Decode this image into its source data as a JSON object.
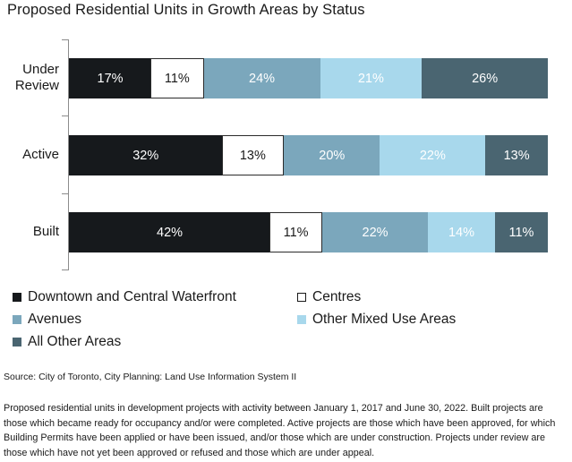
{
  "chart_data": {
    "type": "bar",
    "orientation": "horizontal",
    "stacked": true,
    "normalized": true,
    "title": "Proposed Residential Units in Growth Areas by Status",
    "xlabel": "",
    "ylabel": "",
    "grid": false,
    "legend_position": "bottom",
    "xlim": [
      0,
      100
    ],
    "categories": [
      "Under Review",
      "Active",
      "Built"
    ],
    "series": [
      {
        "name": "Downtown and Central Waterfront",
        "color": "#16191c",
        "text_color": "#ffffff",
        "outlined": false,
        "values": [
          17,
          32,
          42
        ],
        "labels": [
          "17%",
          "32%",
          "42%"
        ]
      },
      {
        "name": "Centres",
        "color": "#ffffff",
        "text_color": "#1a1a1a",
        "outlined": true,
        "values": [
          11,
          13,
          11
        ],
        "labels": [
          "11%",
          "13%",
          "11%"
        ]
      },
      {
        "name": "Avenues",
        "color": "#7ba7bc",
        "text_color": "#ffffff",
        "outlined": false,
        "values": [
          24,
          20,
          22
        ],
        "labels": [
          "24%",
          "20%",
          "22%"
        ]
      },
      {
        "name": "Other Mixed Use Areas",
        "color": "#a8d8ec",
        "text_color": "#ffffff",
        "outlined": false,
        "values": [
          21,
          22,
          14
        ],
        "labels": [
          "21%",
          "22%",
          "14%"
        ]
      },
      {
        "name": "All Other Areas",
        "color": "#4a6571",
        "text_color": "#ffffff",
        "outlined": false,
        "values": [
          26,
          13,
          11
        ],
        "labels": [
          "26%",
          "13%",
          "11%"
        ]
      }
    ]
  },
  "legend": {
    "items": [
      {
        "label": "Downtown and Central Waterfront",
        "color": "#16191c",
        "bordered": false
      },
      {
        "label": "Centres",
        "color": "#ffffff",
        "bordered": true
      },
      {
        "label": "Avenues",
        "color": "#7ba7bc",
        "bordered": false
      },
      {
        "label": "Other Mixed Use Areas",
        "color": "#a8d8ec",
        "bordered": false
      },
      {
        "label": "All Other Areas",
        "color": "#4a6571",
        "bordered": false
      }
    ]
  },
  "footer": {
    "source": "Source: City of Toronto, City Planning: Land Use Information System II",
    "note": "Proposed residential units in development projects with activity between January 1, 2017 and June 30, 2022. Built projects are those which became ready for occupancy and/or were completed.  Active projects are those  which have been approved, for which Building Permits have been applied or have been issued, and/or those which are under  construction. Projects under review are those which have not yet been approved or refused and those which are under appeal."
  },
  "axis": {
    "line_color": "#8c8c8c"
  }
}
